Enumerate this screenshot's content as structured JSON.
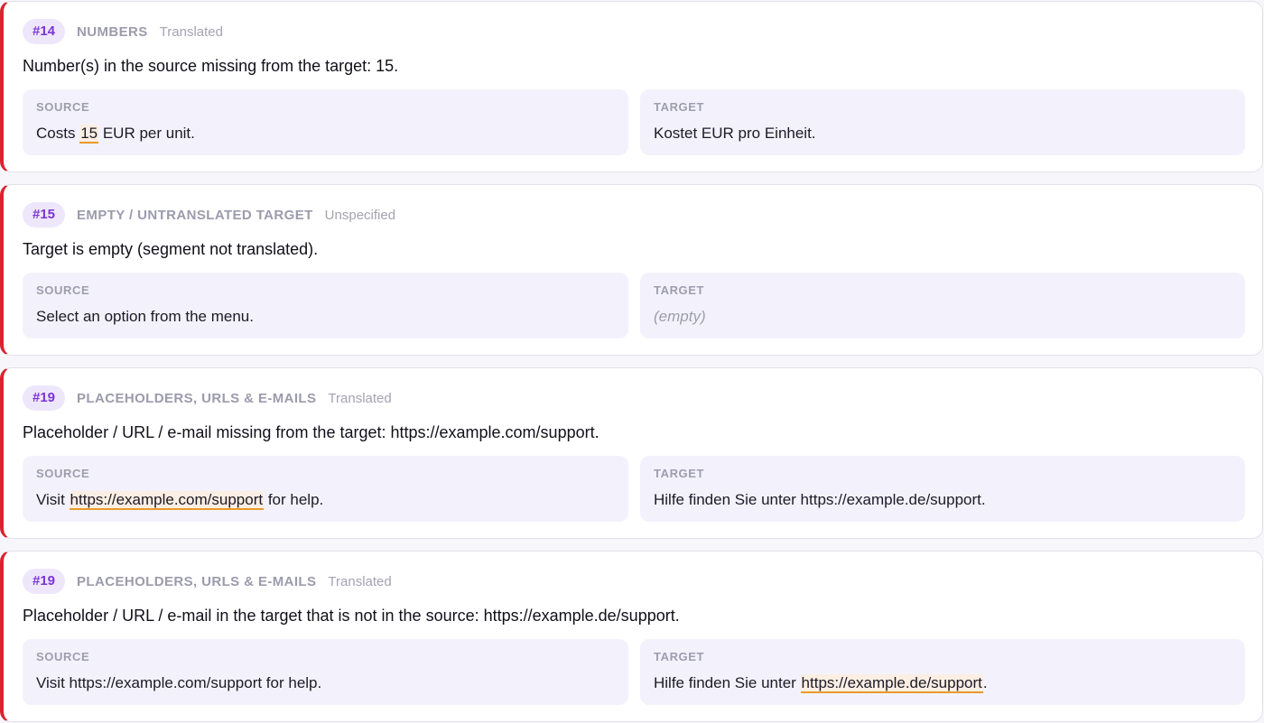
{
  "issues": [
    {
      "number": "#14",
      "category": "NUMBERS",
      "status": "Translated",
      "message": "Number(s) in the source missing from the target: 15.",
      "source_label": "SOURCE",
      "target_label": "TARGET",
      "source": {
        "before": "Costs ",
        "highlight": "15",
        "after": " EUR per unit."
      },
      "target": {
        "before": "Kostet EUR pro Einheit.",
        "highlight": "",
        "after": ""
      }
    },
    {
      "number": "#15",
      "category": "EMPTY / UNTRANSLATED TARGET",
      "status": "Unspecified",
      "message": "Target is empty (segment not translated).",
      "source_label": "SOURCE",
      "target_label": "TARGET",
      "source": {
        "before": "Select an option from the menu.",
        "highlight": "",
        "after": ""
      },
      "target_empty": "(empty)"
    },
    {
      "number": "#19",
      "category": "PLACEHOLDERS, URLS & E-MAILS",
      "status": "Translated",
      "message": "Placeholder / URL / e-mail missing from the target: https://example.com/support.",
      "source_label": "SOURCE",
      "target_label": "TARGET",
      "source": {
        "before": "Visit ",
        "highlight": "https://example.com/support",
        "after": " for help."
      },
      "target": {
        "before": "Hilfe finden Sie unter https://example.de/support.",
        "highlight": "",
        "after": ""
      }
    },
    {
      "number": "#19",
      "category": "PLACEHOLDERS, URLS & E-MAILS",
      "status": "Translated",
      "message": "Placeholder / URL / e-mail in the target that is not in the source: https://example.de/support.",
      "source_label": "SOURCE",
      "target_label": "TARGET",
      "source": {
        "before": "Visit https://example.com/support for help.",
        "highlight": "",
        "after": ""
      },
      "target": {
        "before": "Hilfe finden Sie unter ",
        "highlight": "https://example.de/support",
        "after": "."
      }
    }
  ],
  "colors": {
    "error_accent": "#d8232f",
    "badge_text": "#7a35d6",
    "badge_bg": "#eee7fb",
    "highlight_underline": "#e89a2c"
  }
}
